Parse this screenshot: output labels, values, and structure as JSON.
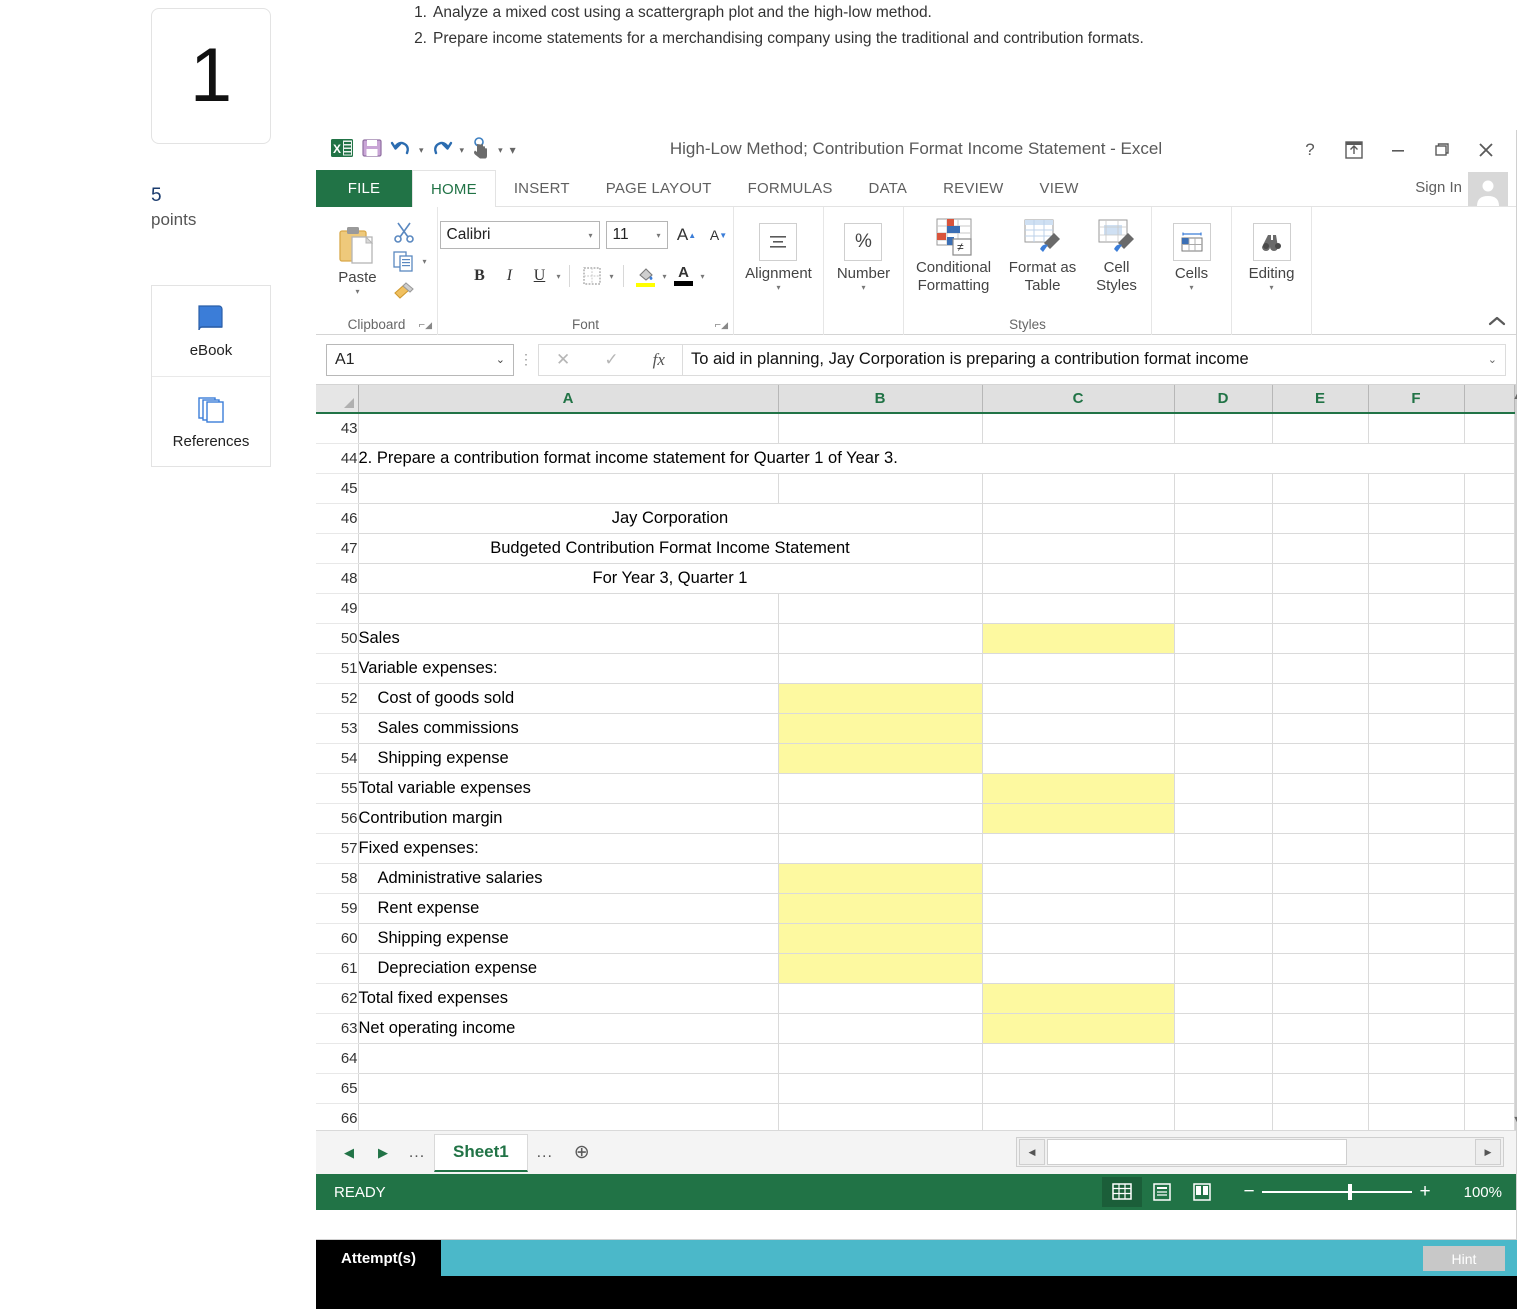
{
  "left_rail": {
    "question_number": "1",
    "points_value": "5",
    "points_label": "points",
    "buttons": [
      {
        "label": "eBook",
        "icon": "book-icon"
      },
      {
        "label": "References",
        "icon": "pages-icon"
      }
    ]
  },
  "instructions": [
    {
      "num": "1.",
      "text": "Analyze a mixed cost using a scattergraph plot and the high-low method."
    },
    {
      "num": "2.",
      "text": "Prepare income statements for a merchandising company using the traditional and contribution formats."
    }
  ],
  "excel": {
    "title": "High-Low Method; Contribution Format Income Statement - Excel",
    "quick_access": [
      "save-icon",
      "undo-icon",
      "redo-icon",
      "touch-mode-icon",
      "customize-qat-icon"
    ],
    "window_buttons": [
      "help-icon",
      "ribbon-display-options-icon",
      "minimize-icon",
      "restore-icon",
      "close-icon"
    ],
    "sign_in": "Sign In",
    "tabs": [
      {
        "label": "FILE",
        "active": false
      },
      {
        "label": "HOME",
        "active": true
      },
      {
        "label": "INSERT",
        "active": false
      },
      {
        "label": "PAGE LAYOUT",
        "active": false
      },
      {
        "label": "FORMULAS",
        "active": false
      },
      {
        "label": "DATA",
        "active": false
      },
      {
        "label": "REVIEW",
        "active": false
      },
      {
        "label": "VIEW",
        "active": false
      }
    ],
    "ribbon": {
      "clipboard": {
        "group": "Clipboard",
        "paste": "Paste",
        "cut_icon": "scissors-icon",
        "copy_icon": "copy-icon",
        "format_painter_icon": "format-painter-icon"
      },
      "font": {
        "group": "Font",
        "font_name": "Calibri",
        "font_size": "11",
        "grow_font": "A",
        "shrink_font": "A",
        "bold": "B",
        "italic": "I",
        "underline": "U",
        "borders_icon": "borders-icon",
        "fill_color_icon": "fill-color-icon",
        "font_color_icon": "font-color-icon"
      },
      "alignment": {
        "label": "Alignment",
        "icon": "alignment-icon"
      },
      "number": {
        "label": "Number",
        "icon": "percent-icon"
      },
      "styles": {
        "group": "Styles",
        "conditional_formatting": "Conditional Formatting",
        "format_as_table": "Format as Table",
        "cell_styles": "Cell Styles"
      },
      "cells": {
        "label": "Cells",
        "icon": "cells-icon"
      },
      "editing": {
        "label": "Editing",
        "icon": "binoculars-icon"
      }
    },
    "formula_bar": {
      "name_box": "A1",
      "cancel_icon": "x-icon",
      "enter_icon": "check-icon",
      "function_icon": "fx-icon",
      "content": "To aid in planning, Jay Corporation is preparing a contribution format income"
    },
    "grid": {
      "columns": [
        "A",
        "B",
        "C",
        "D",
        "E",
        "F"
      ],
      "rows": [
        {
          "n": "43",
          "a": "",
          "b": "",
          "c": "",
          "d": "",
          "e": "",
          "f": "",
          "hl": ""
        },
        {
          "n": "44",
          "a": "2. Prepare a contribution format income statement for Quarter 1 of Year 3.",
          "b": "",
          "c": "",
          "d": "",
          "e": "",
          "f": "",
          "hl": "",
          "span": true
        },
        {
          "n": "45",
          "a": "",
          "b": "",
          "c": "",
          "d": "",
          "e": "",
          "f": "",
          "hl": ""
        },
        {
          "n": "46",
          "a": "Jay Corporation",
          "b": "",
          "c": "",
          "d": "",
          "e": "",
          "f": "",
          "hl": "",
          "center2": true
        },
        {
          "n": "47",
          "a": "Budgeted Contribution Format Income Statement",
          "b": "",
          "c": "",
          "d": "",
          "e": "",
          "f": "",
          "hl": "",
          "center2": true
        },
        {
          "n": "48",
          "a": "For Year 3, Quarter 1",
          "b": "",
          "c": "",
          "d": "",
          "e": "",
          "f": "",
          "hl": "",
          "center2": true
        },
        {
          "n": "49",
          "a": "",
          "b": "",
          "c": "",
          "d": "",
          "e": "",
          "f": "",
          "hl": ""
        },
        {
          "n": "50",
          "a": "Sales",
          "b": "",
          "c": "",
          "d": "",
          "e": "",
          "f": "",
          "hl": "c"
        },
        {
          "n": "51",
          "a": "Variable expenses:",
          "b": "",
          "c": "",
          "d": "",
          "e": "",
          "f": "",
          "hl": ""
        },
        {
          "n": "52",
          "a": "Cost of goods sold",
          "b": "",
          "c": "",
          "d": "",
          "e": "",
          "f": "",
          "hl": "b",
          "indent": true
        },
        {
          "n": "53",
          "a": "Sales commissions",
          "b": "",
          "c": "",
          "d": "",
          "e": "",
          "f": "",
          "hl": "b",
          "indent": true
        },
        {
          "n": "54",
          "a": "Shipping expense",
          "b": "",
          "c": "",
          "d": "",
          "e": "",
          "f": "",
          "hl": "b",
          "indent": true
        },
        {
          "n": "55",
          "a": "Total variable expenses",
          "b": "",
          "c": "",
          "d": "",
          "e": "",
          "f": "",
          "hl": "c"
        },
        {
          "n": "56",
          "a": "Contribution margin",
          "b": "",
          "c": "",
          "d": "",
          "e": "",
          "f": "",
          "hl": "c"
        },
        {
          "n": "57",
          "a": "Fixed expenses:",
          "b": "",
          "c": "",
          "d": "",
          "e": "",
          "f": "",
          "hl": ""
        },
        {
          "n": "58",
          "a": "Administrative salaries",
          "b": "",
          "c": "",
          "d": "",
          "e": "",
          "f": "",
          "hl": "b",
          "indent": true
        },
        {
          "n": "59",
          "a": "Rent expense",
          "b": "",
          "c": "",
          "d": "",
          "e": "",
          "f": "",
          "hl": "b",
          "indent": true
        },
        {
          "n": "60",
          "a": "Shipping expense",
          "b": "",
          "c": "",
          "d": "",
          "e": "",
          "f": "",
          "hl": "b",
          "indent": true
        },
        {
          "n": "61",
          "a": "Depreciation expense",
          "b": "",
          "c": "",
          "d": "",
          "e": "",
          "f": "",
          "hl": "b",
          "indent": true
        },
        {
          "n": "62",
          "a": "Total fixed expenses",
          "b": "",
          "c": "",
          "d": "",
          "e": "",
          "f": "",
          "hl": "c"
        },
        {
          "n": "63",
          "a": "Net operating income",
          "b": "",
          "c": "",
          "d": "",
          "e": "",
          "f": "",
          "hl": "c"
        },
        {
          "n": "64",
          "a": "",
          "b": "",
          "c": "",
          "d": "",
          "e": "",
          "f": "",
          "hl": ""
        },
        {
          "n": "65",
          "a": "",
          "b": "",
          "c": "",
          "d": "",
          "e": "",
          "f": "",
          "hl": ""
        },
        {
          "n": "66",
          "a": "",
          "b": "",
          "c": "",
          "d": "",
          "e": "",
          "f": "",
          "hl": ""
        }
      ]
    },
    "sheet_tabs": {
      "prev_icon": "prev-sheet-icon",
      "next_icon": "next-sheet-icon",
      "dots_left": "...",
      "active_sheet": "Sheet1",
      "dots_right": "...",
      "add_sheet_icon": "add-sheet-icon"
    },
    "status_bar": {
      "status": "READY",
      "view_normal_icon": "normal-view-icon",
      "view_pagelayout_icon": "page-layout-view-icon",
      "view_pagebreak_icon": "page-break-view-icon",
      "zoom_out": "−",
      "zoom_in": "+",
      "zoom_level": "100%"
    }
  },
  "attempt_bar": {
    "label": "Attempt(s)",
    "hint_label": "Hint"
  },
  "colors": {
    "excel_green": "#217346",
    "highlight_yellow": "#fdf9a0",
    "attempt_teal": "#4bb8c9",
    "points_blue": "#1a3b6e"
  }
}
